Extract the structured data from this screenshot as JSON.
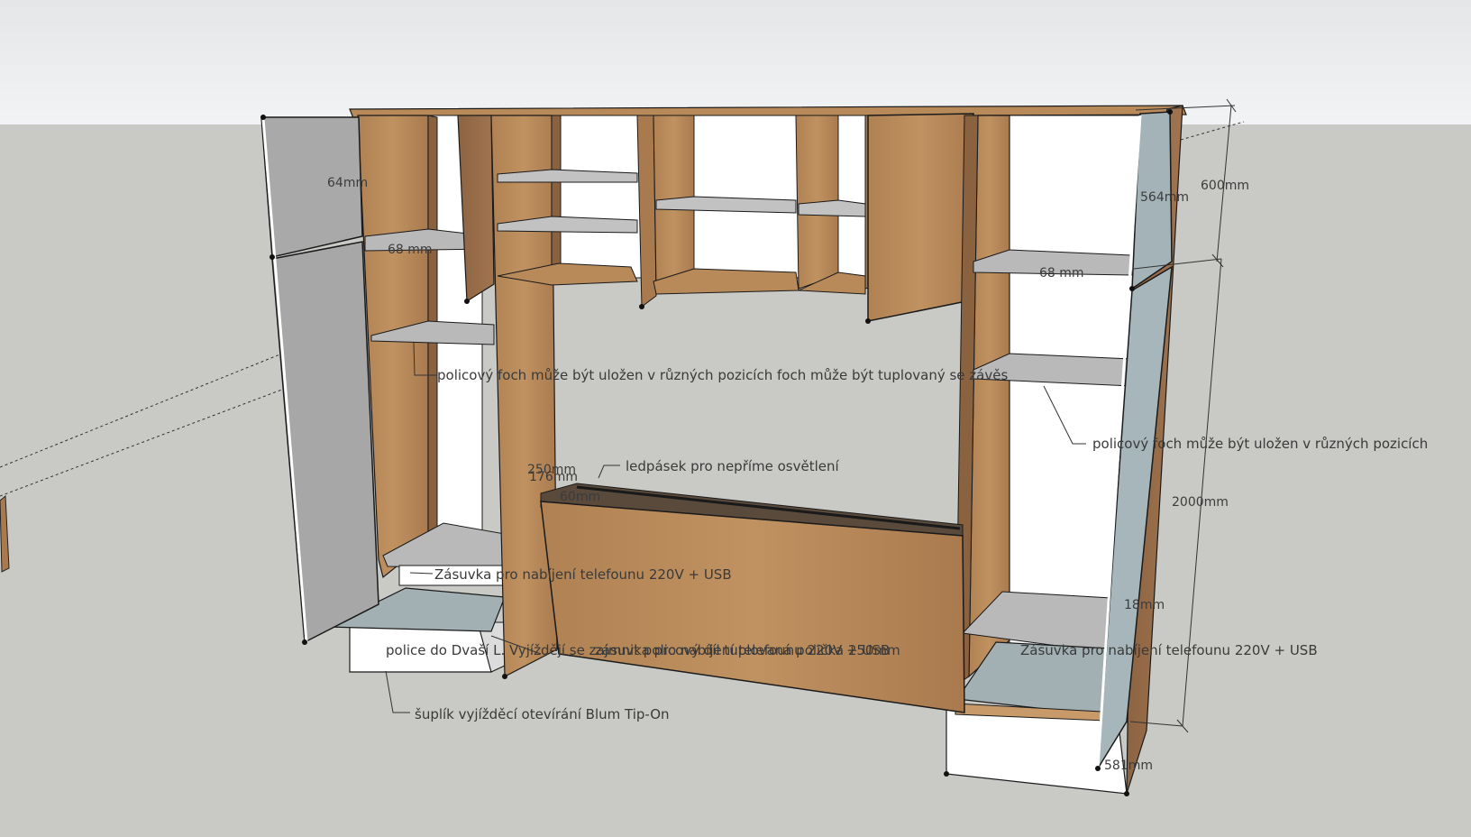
{
  "dimensions": {
    "d64": "64mm",
    "d600": "600mm",
    "d564": "564mm",
    "d68a": "68 mm",
    "d68b": "68 mm",
    "d2000": "2000mm",
    "d250": "250mm",
    "d176": "176mm",
    "d60": "60mm",
    "d18": "18mm",
    "d581": "581mm"
  },
  "notes": {
    "shelf_positions_tuple": "policový foch může být uložen v různých pozicích foch může být tuplovaný se závěs",
    "shelf_positions_right": "policový foch může být uložen v různých pozicích",
    "ledstrip": "ledpásek pro nepříme osvětlení",
    "socket_left": "Zásuvka pro nabíjení telefounu 220V + USB",
    "shelf_overlap": "police do  Dvaší L. Vyjíždějí se zajmnit policový díl tuplovaná polička 250mm",
    "socket_mid": "zásuvka pro nabíjení telefounu 220V + USB",
    "socket_right": "Zásuvka pro nabíjení telefounu 220V + USB",
    "drawer": "šuplík vyjížděcí otevírání Blum Tip-On"
  },
  "colors": {
    "sky": "#e9ebec",
    "floor": "#c9c9c6",
    "wood": "#a97a4e",
    "wood_light": "#b88a5a",
    "wood_dark": "#8a6240",
    "door_grey": "#a9a9a9",
    "door_blue": "#a3b3b8",
    "shelf_grey": "#b9b9b9",
    "white": "#ffffff",
    "line": "#1a1a1a"
  }
}
